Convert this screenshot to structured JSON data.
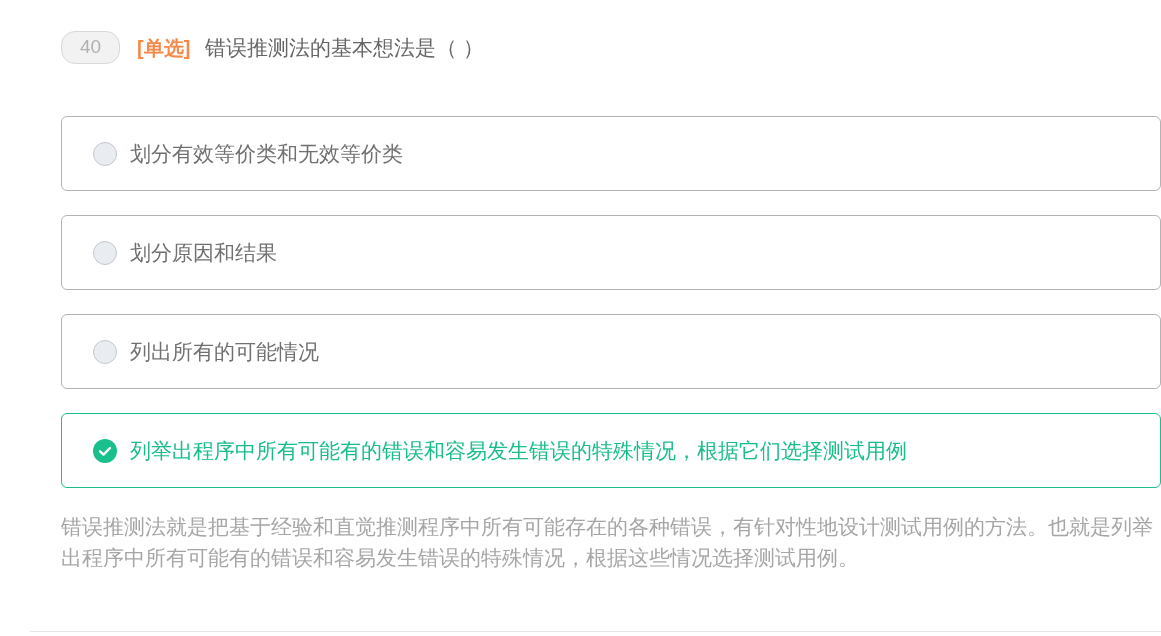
{
  "question": {
    "number": "40",
    "type_tag": "[单选]",
    "text": "错误推测法的基本想法是（ ）"
  },
  "options": [
    {
      "text": "划分有效等价类和无效等价类",
      "selected": false
    },
    {
      "text": "划分原因和结果",
      "selected": false
    },
    {
      "text": "列出所有的可能情况",
      "selected": false
    },
    {
      "text": "列举出程序中所有可能有的错误和容易发生错误的特殊情况，根据它们选择测试用例",
      "selected": true
    }
  ],
  "explanation": "错误推测法就是把基于经验和直觉推测程序中所有可能存在的各种错误，有针对性地设计测试用例的方法。也就是列举出程序中所有可能有的错误和容易发生错误的特殊情况，根据这些情况选择测试用例。"
}
